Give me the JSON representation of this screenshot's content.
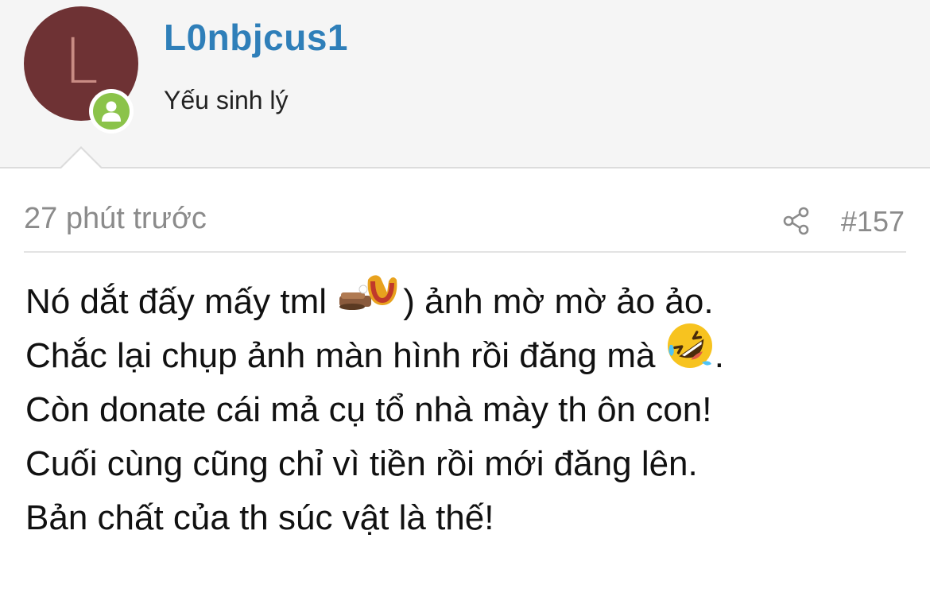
{
  "user": {
    "avatar_letter": "L",
    "avatar_color": "#6e3234",
    "online_color": "#8bc34a",
    "name": "L0nbjcus1",
    "name_color": "#2f7fb9",
    "title": "Yếu sinh lý"
  },
  "post": {
    "time": "27 phút trước",
    "number": "#157",
    "share_icon": "share-icon",
    "line1_a": "Nó dắt đấy mấy tml ",
    "line1_b": ") ảnh mờ mờ ảo ảo.",
    "line2_a": "Chắc lại chụp ảnh màn hình rồi đăng mà ",
    "line2_b": ".",
    "line3": "Còn donate cái mả cụ tổ nhà mày th ôn con!",
    "line4": "Cuối cùng cũng chỉ vì tiền rồi mới đăng lên.",
    "line5": "Bản chất của th súc vật là thế!",
    "emoji_1": "sticker-emoji",
    "emoji_2": "rolling-laughing-emoji"
  }
}
